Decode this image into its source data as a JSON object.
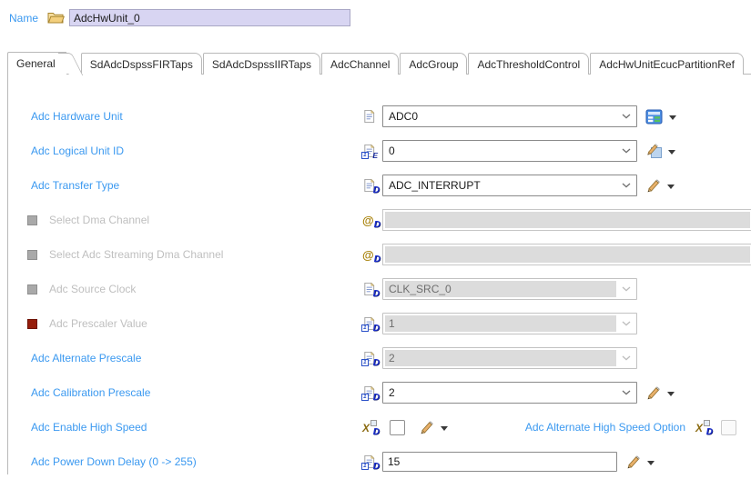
{
  "colors": {
    "label_blue": "#3b99f0",
    "disabled_text": "#bfbfbf",
    "disabled_fill": "#dcdcdc",
    "name_field_bg": "#d8d5f2",
    "gray_bullet": "#a9a9a9",
    "red_bullet": "#961d0c"
  },
  "name_row": {
    "label": "Name",
    "value": "AdcHwUnit_0",
    "icon": "open-folder-icon"
  },
  "tabs": [
    "General",
    "SdAdcDspssFIRTaps",
    "SdAdcDspssIIRTaps",
    "AdcChannel",
    "AdcGroup",
    "AdcThresholdControl",
    "AdcHwUnitEcucPartitionRef"
  ],
  "active_tab": "General",
  "rows": [
    {
      "label": "Adc Hardware Unit",
      "value": "ADC0",
      "control": "combobox",
      "state": "enabled",
      "field_icon": "document-icon",
      "trailing": [
        "form-editor-icon",
        "dropdown-arrow"
      ]
    },
    {
      "label": "Adc Logical Unit ID",
      "value": "0",
      "control": "combobox",
      "state": "enabled",
      "field_icon": "document-integer-icon",
      "trailing": [
        "pencil-square-icon",
        "dropdown-arrow"
      ]
    },
    {
      "label": "Adc Transfer Type",
      "value": "ADC_INTERRUPT",
      "control": "combobox",
      "state": "enabled",
      "field_icon": "document-default-icon",
      "trailing": [
        "pencil-icon",
        "dropdown-arrow"
      ]
    },
    {
      "label": "Select Dma Channel",
      "value": "",
      "control": "reference-field",
      "state": "disabled",
      "bullet": "gray",
      "field_icon": "reference-default-icon"
    },
    {
      "label": "Select Adc Streaming Dma Channel",
      "value": "",
      "control": "reference-field",
      "state": "disabled",
      "bullet": "gray",
      "field_icon": "reference-default-icon"
    },
    {
      "label": "Adc Source Clock",
      "value": "CLK_SRC_0",
      "control": "combobox",
      "state": "disabled",
      "bullet": "gray",
      "field_icon": "document-default-icon"
    },
    {
      "label": "Adc Prescaler Value",
      "value": "1",
      "control": "combobox",
      "state": "disabled",
      "bullet": "red",
      "field_icon": "document-integer-default-icon"
    },
    {
      "label": "Adc Alternate Prescale",
      "value": "2",
      "control": "combobox",
      "state": "field-disabled",
      "field_icon": "document-integer-default-icon"
    },
    {
      "label": "Adc Calibration Prescale",
      "value": "2",
      "control": "combobox",
      "state": "enabled",
      "field_icon": "document-integer-default-icon",
      "trailing": [
        "pencil-icon",
        "dropdown-arrow"
      ]
    },
    {
      "label": "Adc Enable High Speed",
      "control": "checkbox",
      "checked": false,
      "state": "enabled",
      "field_icon": "boolean-default-icon",
      "trailing": [
        "pencil-icon",
        "dropdown-arrow"
      ],
      "right": {
        "label": "Adc Alternate High Speed Option",
        "icon": "boolean-default-icon",
        "control": "checkbox",
        "checked": false,
        "state": "disabled"
      }
    },
    {
      "label": "Adc Power Down Delay (0 -> 255)",
      "value": "15",
      "control": "textbox",
      "state": "enabled",
      "field_icon": "document-integer-default-icon",
      "trailing": [
        "pencil-icon",
        "dropdown-arrow"
      ]
    }
  ]
}
